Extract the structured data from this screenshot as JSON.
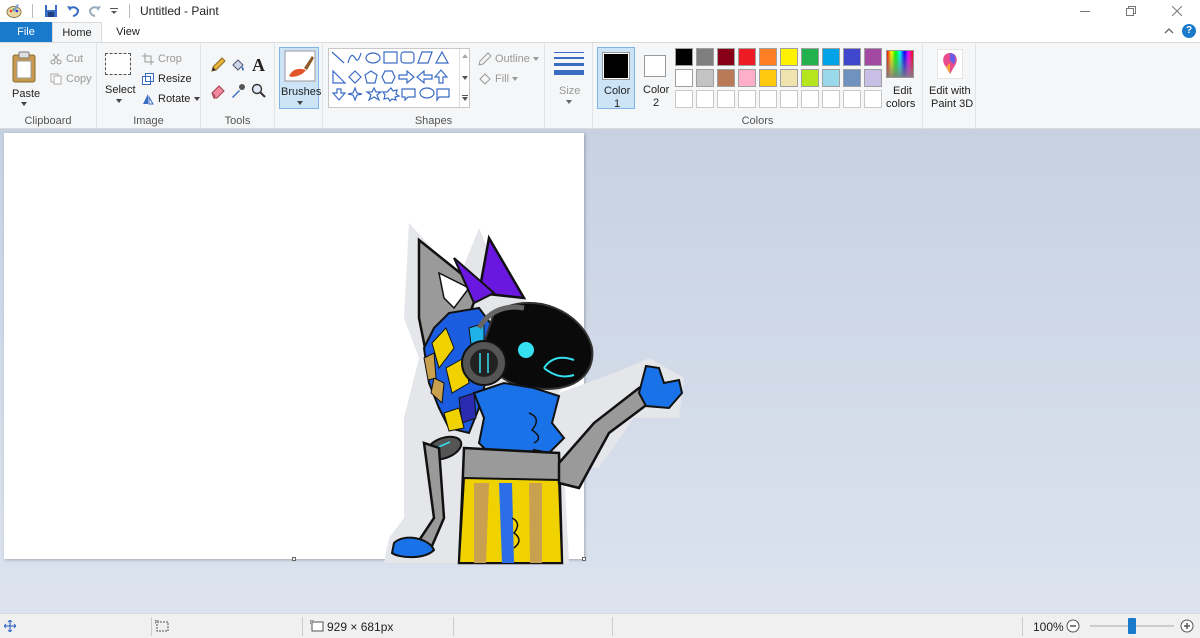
{
  "window": {
    "title": "Untitled - Paint",
    "minimize_icon": "minimize-icon",
    "restore_icon": "restore-icon",
    "close_icon": "close-icon"
  },
  "tabs": {
    "file": "File",
    "home": "Home",
    "view": "View"
  },
  "clipboard": {
    "paste": "Paste",
    "cut": "Cut",
    "copy": "Copy",
    "label": "Clipboard"
  },
  "image": {
    "select": "Select",
    "crop": "Crop",
    "resize": "Resize",
    "rotate": "Rotate",
    "label": "Image"
  },
  "tools": {
    "label": "Tools"
  },
  "brushes": {
    "label": "Brushes"
  },
  "shapes": {
    "outline": "Outline",
    "fill": "Fill",
    "label": "Shapes"
  },
  "size": {
    "label": "Size"
  },
  "colors": {
    "color1": "Color",
    "color1_num": "1",
    "color2": "Color",
    "color2_num": "2",
    "edit_colors_1": "Edit",
    "edit_colors_2": "colors",
    "edit_paint3d_1": "Edit with",
    "edit_paint3d_2": "Paint 3D",
    "label": "Colors",
    "color1_value": "#000000",
    "color2_value": "#ffffff",
    "palette_row1": [
      "#000000",
      "#7f7f7f",
      "#880015",
      "#ed1c24",
      "#ff7f27",
      "#fff200",
      "#22b14c",
      "#00a2e8",
      "#3f48cc",
      "#a349a4"
    ],
    "palette_row2": [
      "#ffffff",
      "#c3c3c3",
      "#b97a57",
      "#ffaec9",
      "#ffc90e",
      "#efe4b0",
      "#b5e61d",
      "#99d9ea",
      "#7092be",
      "#c8bfe7"
    ]
  },
  "status": {
    "dimensions": "929 × 681px",
    "zoom": "100%",
    "zoom_fraction": 0.5
  }
}
